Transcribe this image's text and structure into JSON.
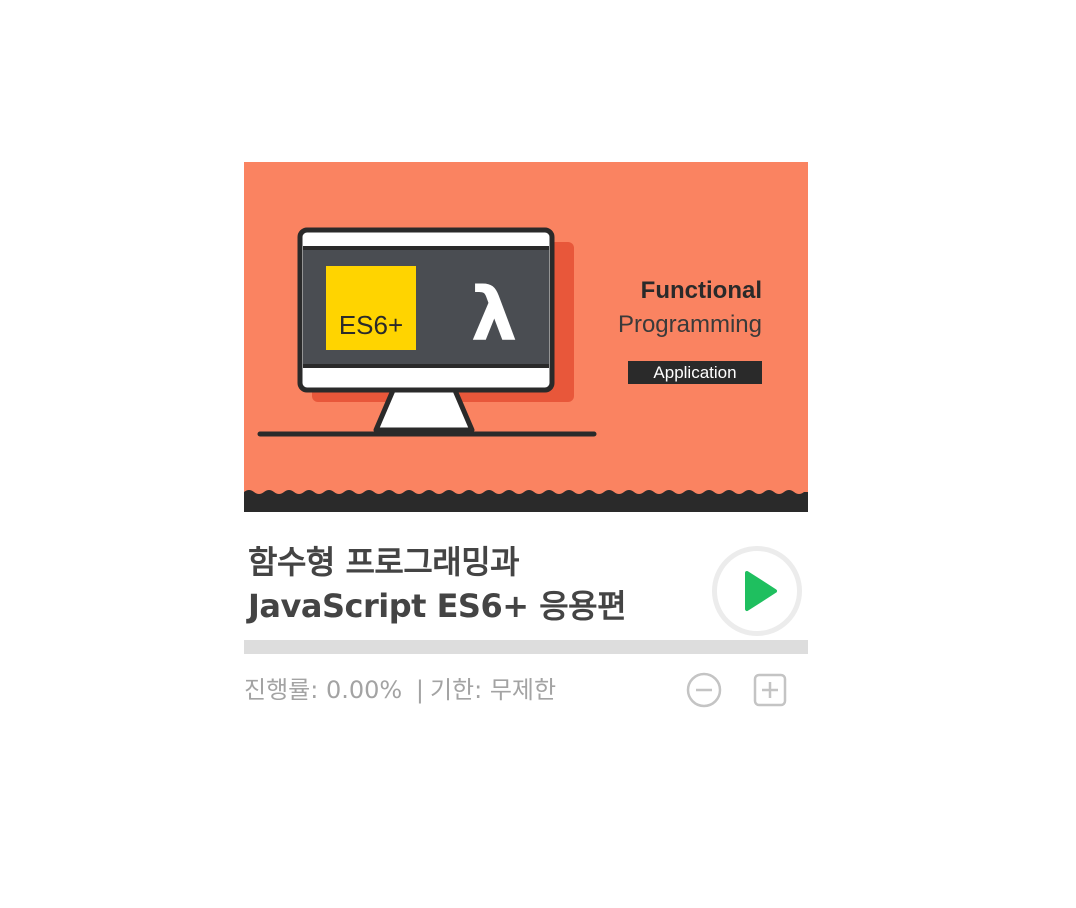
{
  "course": {
    "thumbnail": {
      "bg_color": "#fa8361",
      "badge": "ES6+",
      "lambda": "λ",
      "heading_line1": "Functional",
      "heading_line2": "Programming",
      "tag": "Application"
    },
    "title_line1": "함수형 프로그래밍과",
    "title_line2": "JavaScript ES6+ 응용편",
    "progress_percent": 0.0,
    "progress_label": "진행률:",
    "progress_value": "0.00%",
    "separator": "|",
    "deadline_label": "기한:",
    "deadline_value": "무제한",
    "play_color": "#1fbf5f",
    "play_icon": "play-icon",
    "decrease_icon": "minus-circle-icon",
    "increase_icon": "plus-square-icon"
  }
}
